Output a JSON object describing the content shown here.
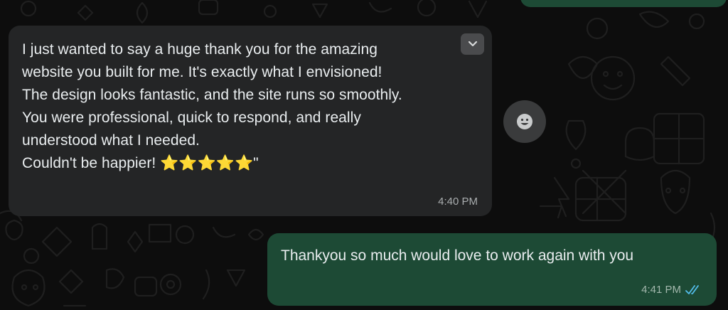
{
  "messages": {
    "incoming": {
      "text": "I just wanted to say a huge thank you for the amazing\nwebsite you built for me. It's exactly what I envisioned!\nThe design looks fantastic, and the site runs so smoothly.\nYou were professional, quick to respond, and really\nunderstood what I needed.\nCouldn't be happier! ⭐⭐⭐⭐⭐\"",
      "time": "4:40 PM"
    },
    "outgoing": {
      "text": "Thankyou so much would love to work again with you",
      "time": "4:41 PM",
      "status": "read"
    }
  },
  "icons": {
    "dropdown": "chevron-down-icon",
    "react": "emoji-smile-icon",
    "read_receipt": "double-check-icon"
  },
  "colors": {
    "background": "#0d0d0d",
    "incoming_bubble": "#242526",
    "outgoing_bubble": "#1d4a35",
    "text": "#e9edef",
    "read_tick": "#53bdeb"
  }
}
